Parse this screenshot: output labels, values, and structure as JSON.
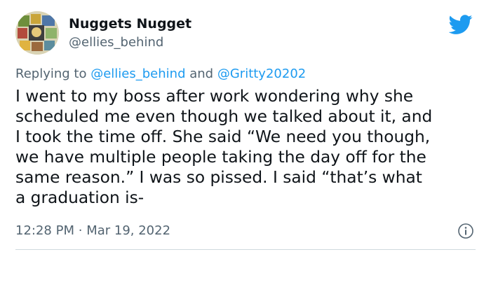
{
  "tweet": {
    "author": {
      "display_name": "Nuggets Nugget",
      "handle": "@ellies_behind"
    },
    "reply": {
      "prefix": "Replying to",
      "mention_1": "@ellies_behind",
      "joiner": "and",
      "mention_2": "@Gritty20202"
    },
    "body_lines": [
      "I went to my boss after work wondering why she",
      "scheduled me even though we talked about it, and",
      "I took the time off. She said “We need you though,",
      "we have multiple people taking the day off for the",
      "same reason.” I was so pissed. I said “that’s what",
      "a graduation is-"
    ],
    "time": "12:28 PM",
    "separator": "·",
    "date": "Mar 19, 2022"
  },
  "icons": {
    "brand": "twitter-bird-icon",
    "info": "info-icon"
  },
  "colors": {
    "accent": "#1d9bf0",
    "secondary_text": "#536471",
    "primary_text": "#0f1419",
    "divider": "#cfd9de"
  }
}
